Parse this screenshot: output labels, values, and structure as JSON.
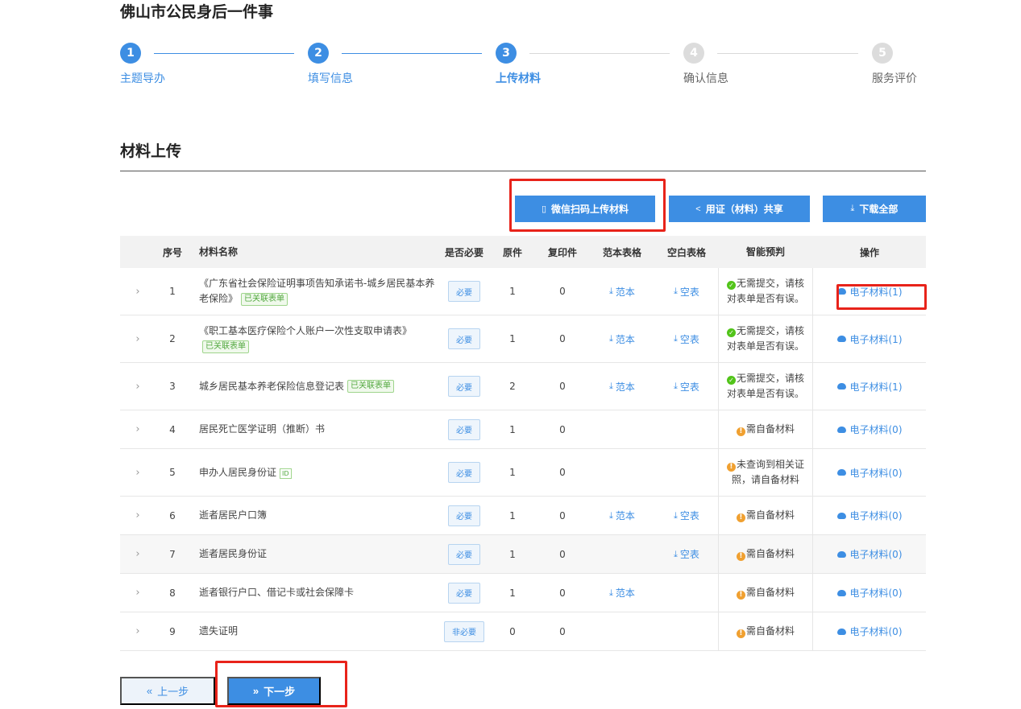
{
  "page_title": "佛山市公民身后一件事",
  "steps": [
    {
      "num": "1",
      "label": "主题导办"
    },
    {
      "num": "2",
      "label": "填写信息"
    },
    {
      "num": "3",
      "label": "上传材料"
    },
    {
      "num": "4",
      "label": "确认信息"
    },
    {
      "num": "5",
      "label": "服务评价"
    }
  ],
  "section_title": "材料上传",
  "actions": {
    "wechat_label": "微信扫码上传材料",
    "share_label": "用证（材料）共享",
    "download_all_label": "下载全部"
  },
  "table": {
    "headers": {
      "no": "序号",
      "name": "材料名称",
      "required": "是否必要",
      "original": "原件",
      "copy": "复印件",
      "sample": "范本表格",
      "blank": "空白表格",
      "smart": "智能预判",
      "op": "操作"
    },
    "rows": [
      {
        "no": "1",
        "name": "《广东省社会保险证明事项告知承诺书-城乡居民基本养老保险》",
        "tag": "已关联表单",
        "required": "必要",
        "original": "1",
        "copy": "0",
        "sample": "范本",
        "blank": "空表",
        "smart": "无需提交，请核对表单是否有误。",
        "op": "电子材料(1)"
      },
      {
        "no": "2",
        "name": "《职工基本医疗保险个人账户一次性支取申请表》",
        "tag": "已关联表单",
        "required": "必要",
        "original": "1",
        "copy": "0",
        "sample": "范本",
        "blank": "空表",
        "smart": "无需提交，请核对表单是否有误。",
        "op": "电子材料(1)"
      },
      {
        "no": "3",
        "name": "城乡居民基本养老保险信息登记表",
        "tag": "已关联表单",
        "required": "必要",
        "original": "2",
        "copy": "0",
        "sample": "范本",
        "blank": "空表",
        "smart": "无需提交，请核对表单是否有误。",
        "op": "电子材料(1)"
      },
      {
        "no": "4",
        "name": "居民死亡医学证明（推断）书",
        "required": "必要",
        "original": "1",
        "copy": "0",
        "smart": "需自备材料",
        "op": "电子材料(0)"
      },
      {
        "no": "5",
        "name": "申办人居民身份证",
        "id_tag": "ID",
        "required": "必要",
        "original": "1",
        "copy": "0",
        "smart": "未查询到相关证照，请自备材料",
        "op": "电子材料(0)"
      },
      {
        "no": "6",
        "name": "逝者居民户口簿",
        "required": "必要",
        "original": "1",
        "copy": "0",
        "sample": "范本",
        "blank": "空表",
        "smart": "需自备材料",
        "op": "电子材料(0)"
      },
      {
        "no": "7",
        "name": "逝者居民身份证",
        "required": "必要",
        "original": "1",
        "copy": "0",
        "blank": "空表",
        "smart": "需自备材料",
        "op": "电子材料(0)"
      },
      {
        "no": "8",
        "name": "逝者银行户口、借记卡或社会保障卡",
        "required": "必要",
        "original": "1",
        "copy": "0",
        "sample": "范本",
        "smart": "需自备材料",
        "op": "电子材料(0)"
      },
      {
        "no": "9",
        "name": "遗失证明",
        "required": "非必要",
        "original": "0",
        "copy": "0",
        "smart": "需自备材料",
        "op": "电子材料(0)"
      }
    ]
  },
  "nav": {
    "prev_label": "上一步",
    "next_label": "下一步"
  },
  "colors": {
    "accent": "#3d8ee3",
    "highlight": "#e8231a",
    "ok": "#52c41a",
    "warn": "#f0a030"
  }
}
